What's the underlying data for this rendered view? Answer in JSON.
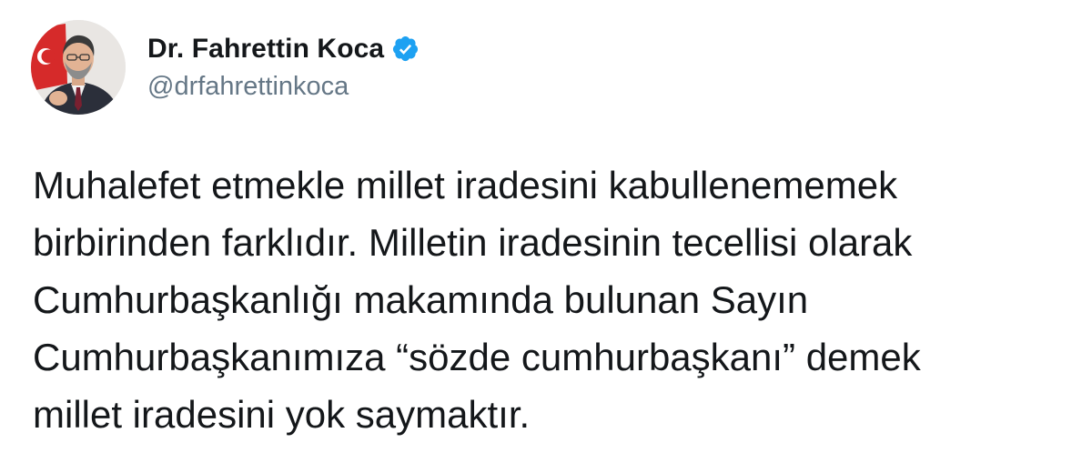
{
  "author": {
    "display_name": "Dr. Fahrettin Koca",
    "handle": "@drfahrettinkoca",
    "verified": true,
    "verified_icon": "verified-badge-icon",
    "avatar_icon": "profile-photo"
  },
  "tweet": {
    "text": "Muhalefet etmekle millet iradesini kabullenememek\nbirbirinden farklıdır. Milletin iradesinin tecellisi olarak\nCumhurbaşkanlığı makamında bulunan Sayın\nCumhurbaşkanımıza “sözde cumhurbaşkanı” demek\nmillet iradesini yok saymaktır."
  },
  "colors": {
    "text": "#14171a",
    "handle": "#657786",
    "verified_blue": "#1da1f2",
    "background": "#ffffff"
  }
}
